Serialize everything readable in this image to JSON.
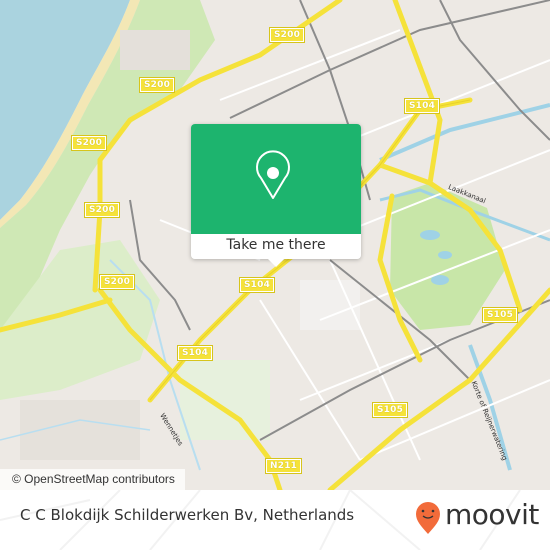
{
  "map": {
    "colors": {
      "land": "#ede9e4",
      "sea": "#aad3df",
      "beach": "#f3e7b5",
      "park": "#cfe8b5",
      "road_major": "#f5e23a",
      "road_minor": "#ffffff",
      "rail": "#8c8c8c",
      "water": "#9fd2e6"
    },
    "route_shields": [
      {
        "label": "S200"
      },
      {
        "label": "S200"
      },
      {
        "label": "S200"
      },
      {
        "label": "S200"
      },
      {
        "label": "S200"
      },
      {
        "label": "S104"
      },
      {
        "label": "S104"
      },
      {
        "label": "S104"
      },
      {
        "label": "S105"
      },
      {
        "label": "S105"
      },
      {
        "label": "N211"
      }
    ],
    "street_labels": [
      {
        "label": "Laakkanaal"
      },
      {
        "label": "Korte of Reijnerwatering"
      },
      {
        "label": "Wennetjes"
      }
    ],
    "attribution": "© OpenStreetMap contributors"
  },
  "popup": {
    "icon": "map-pin-icon",
    "button_label": "Take me there",
    "color": "#1db46e"
  },
  "footer": {
    "place_name": "C C Blokdijk Schilderwerken Bv, Netherlands",
    "brand": {
      "name": "moovit",
      "icon": "moovit-pin-icon",
      "color": "#f26b3a"
    }
  }
}
